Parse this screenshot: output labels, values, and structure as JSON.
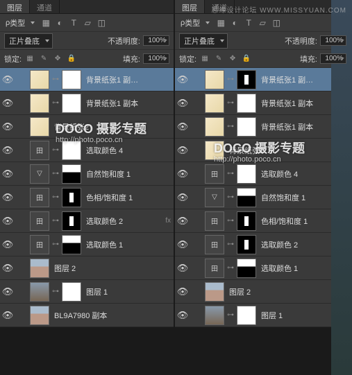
{
  "watermark_top": "思缘设计论坛 WWW.MISSYUAN.COM",
  "watermark_main": "DOCO 摄影专题",
  "watermark_sub": "http://photo.poco.cn",
  "panel": {
    "tab1": "图层",
    "tab2": "通道",
    "type_label": "类型",
    "blend_mode": "正片叠底",
    "opacity_label": "不透明度:",
    "opacity_val": "100%",
    "lock_label": "锁定:",
    "fill_label": "填充:",
    "fill_val": "100%"
  },
  "layersA": [
    {
      "name": "背景纸张1 副…",
      "t": "paper",
      "m": "mask",
      "sel": true
    },
    {
      "name": "背景纸张1 副本",
      "t": "paper",
      "m": "mask"
    },
    {
      "name": "背景纸张2",
      "t": "paper"
    },
    {
      "name": "选取颜色 4",
      "t": "adj",
      "m": "mask",
      "adj": "田"
    },
    {
      "name": "自然饱和度 1",
      "t": "adj",
      "m": "mask-mix",
      "adj": "▽"
    },
    {
      "name": "色相/饱和度 1",
      "t": "adj",
      "m": "mask-sil",
      "adj": "田"
    },
    {
      "name": "选取颜色 2",
      "t": "adj",
      "m": "mask-sil",
      "adj": "田",
      "fx": true
    },
    {
      "name": "选取颜色 1",
      "t": "adj",
      "m": "mask-mix",
      "adj": "田"
    },
    {
      "name": "图层 2",
      "t": "photo"
    },
    {
      "name": "图层 1",
      "t": "photo2",
      "m": "mask"
    },
    {
      "name": "BL9A7980 副本",
      "t": "photo"
    }
  ],
  "layersB": [
    {
      "name": "背景纸张1 副…",
      "t": "paper",
      "m": "mask-sil",
      "sel": true
    },
    {
      "name": "背景纸张1 副本",
      "t": "paper",
      "m": "mask"
    },
    {
      "name": "背景纸张1 副本",
      "t": "paper",
      "m": "mask"
    },
    {
      "name": "背景纸张2",
      "t": "paper"
    },
    {
      "name": "选取颜色 4",
      "t": "adj",
      "m": "mask",
      "adj": "田"
    },
    {
      "name": "自然饱和度 1",
      "t": "adj",
      "m": "mask-mix",
      "adj": "▽"
    },
    {
      "name": "色相/饱和度 1",
      "t": "adj",
      "m": "mask-sil",
      "adj": "田"
    },
    {
      "name": "选取颜色 2",
      "t": "adj",
      "m": "mask-sil",
      "adj": "田",
      "fx": true
    },
    {
      "name": "选取颜色 1",
      "t": "adj",
      "m": "mask-mix",
      "adj": "田"
    },
    {
      "name": "图层 2",
      "t": "photo"
    },
    {
      "name": "图层 1",
      "t": "photo2",
      "m": "mask"
    }
  ]
}
